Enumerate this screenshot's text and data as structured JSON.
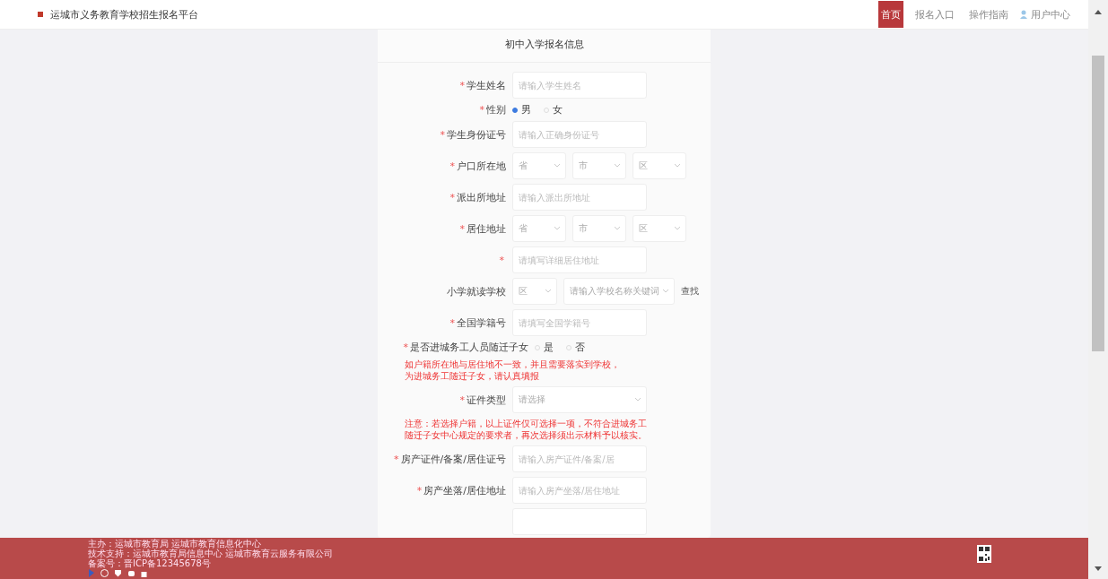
{
  "header": {
    "title": "运城市义务教育学校招生报名平台",
    "nav": [
      {
        "label": "首页",
        "selected": true
      },
      {
        "label": "报名入口",
        "selected": false
      },
      {
        "label": "操作指南",
        "selected": false
      }
    ],
    "user": "用户中心"
  },
  "form": {
    "title": "初中入学报名信息",
    "rows": [
      {
        "kind": "input",
        "label": "学生姓名",
        "mark": "*",
        "placeholder": "请输入学生姓名"
      },
      {
        "kind": "radio",
        "label": "性别",
        "mark": "*",
        "options": [
          {
            "label": "男",
            "selected": true
          },
          {
            "label": "女",
            "selected": false
          }
        ]
      },
      {
        "kind": "input",
        "label": "学生身份证号",
        "mark": "*",
        "placeholder": "请输入正确身份证号"
      },
      {
        "kind": "selects",
        "label": "户口所在地",
        "mark": "*",
        "selects": [
          "省",
          "市",
          "区"
        ]
      },
      {
        "kind": "input",
        "label": "派出所地址",
        "mark": "*",
        "placeholder": "请输入派出所地址"
      },
      {
        "kind": "selects",
        "label": "居住地址",
        "mark": "*",
        "selects": [
          "省",
          "市",
          "区"
        ]
      },
      {
        "kind": "input",
        "mark": "*",
        "placeholder": "请填写详细居住地址"
      },
      {
        "kind": "school",
        "label": "小学就读学校",
        "selects": [
          "区",
          "请输入学校名称关键词"
        ],
        "link": "查找"
      },
      {
        "kind": "input",
        "label": "全国学籍号",
        "mark": "*",
        "placeholder": "请填写全国学籍号"
      },
      {
        "kind": "radio",
        "label": "是否进城务工人员随迁子女",
        "mark": "*",
        "options": [
          {
            "label": "是",
            "selected": false
          },
          {
            "label": "否",
            "selected": false
          }
        ]
      },
      {
        "kind": "note",
        "lines": [
          "如户籍所在地与居住地不一致，并且需要落实到学校，",
          "为进城务工随迁子女，请认真填报"
        ]
      },
      {
        "kind": "select",
        "label": "证件类型",
        "mark": "*",
        "placeholder": "请选择"
      },
      {
        "kind": "note",
        "lines": [
          "注意：若选择户籍，以上证件仅可选择一项，不符合进城务工",
          "随迁子女中心规定的要求者，再次选择须出示材料予以核实。"
        ]
      },
      {
        "kind": "input",
        "label": "房产证件/备案/居住证号",
        "mark": "*",
        "placeholder": "请输入房产证件/备案/居"
      },
      {
        "kind": "input",
        "label": "房产坐落/居住地址",
        "mark": "*",
        "placeholder": "请输入房产坐落/居住地址"
      },
      {
        "kind": "input"
      }
    ]
  },
  "footer": {
    "lines": [
      "主办：运城市教育局  运城市教育信息化中心",
      "技术支持：运城市教育局信息中心  运城市教育云服务有限公司",
      "备案号：晋ICP备12345678号"
    ]
  }
}
